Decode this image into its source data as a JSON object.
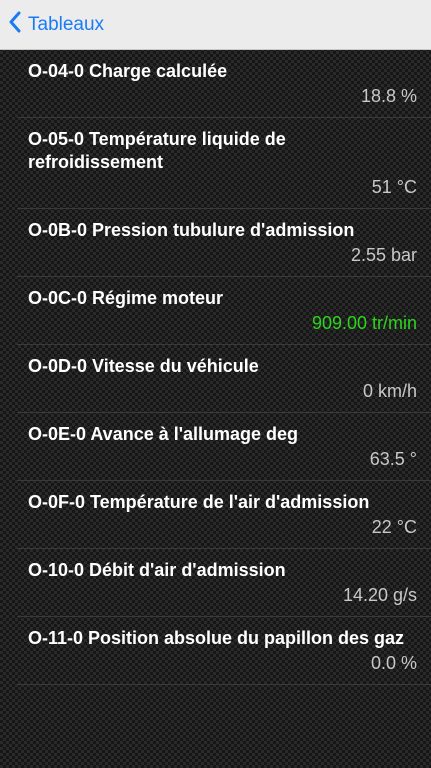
{
  "nav": {
    "back_label": "Tableaux"
  },
  "colors": {
    "accent": "#1a7cf5",
    "value_highlight": "#2bd61c",
    "value_default": "#c8c8c8"
  },
  "rows": [
    {
      "title": "O-04-0 Charge calculée",
      "value": "18.8 %",
      "highlight": false
    },
    {
      "title": "O-05-0 Température liquide de refroidissement",
      "value": "51 °C",
      "highlight": false
    },
    {
      "title": "O-0B-0 Pression tubulure d'admission",
      "value": "2.55 bar",
      "highlight": false
    },
    {
      "title": "O-0C-0 Régime moteur",
      "value": "909.00 tr/min",
      "highlight": true
    },
    {
      "title": "O-0D-0 Vitesse du véhicule",
      "value": "0 km/h",
      "highlight": false
    },
    {
      "title": "O-0E-0 Avance à l'allumage deg",
      "value": "63.5 °",
      "highlight": false
    },
    {
      "title": "O-0F-0 Température de l'air d'admission",
      "value": "22 °C",
      "highlight": false
    },
    {
      "title": "O-10-0 Débit d'air d'admission",
      "value": "14.20 g/s",
      "highlight": false
    },
    {
      "title": "O-11-0 Position absolue du papillon des gaz",
      "value": "0.0 %",
      "highlight": false
    }
  ]
}
